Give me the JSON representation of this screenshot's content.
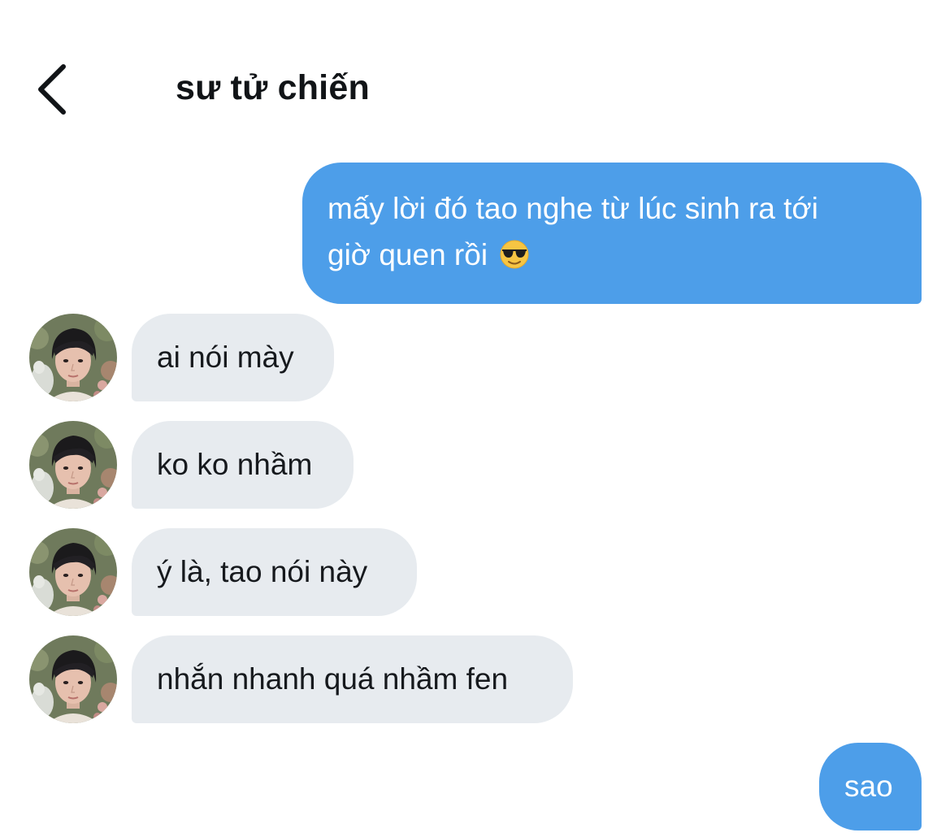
{
  "header": {
    "title": "sư tử chiến",
    "back_icon": "chevron-left-icon"
  },
  "messages": [
    {
      "direction": "outgoing",
      "lines": [
        "mấy lời đó tao nghe từ lúc sinh ra tới",
        "giờ quen rồi"
      ],
      "emoji": "sunglasses-face"
    },
    {
      "direction": "incoming",
      "text": "ai nói mày"
    },
    {
      "direction": "incoming",
      "text": "ko ko nhầm"
    },
    {
      "direction": "incoming",
      "text": "ý là, tao nói này"
    },
    {
      "direction": "incoming",
      "text": "nhắn nhanh quá nhầm fen"
    },
    {
      "direction": "outgoing",
      "text": "sao"
    }
  ],
  "colors": {
    "outgoing_bubble": "#4d9ee9",
    "incoming_bubble": "#e7ebef",
    "title_text": "#111417"
  }
}
